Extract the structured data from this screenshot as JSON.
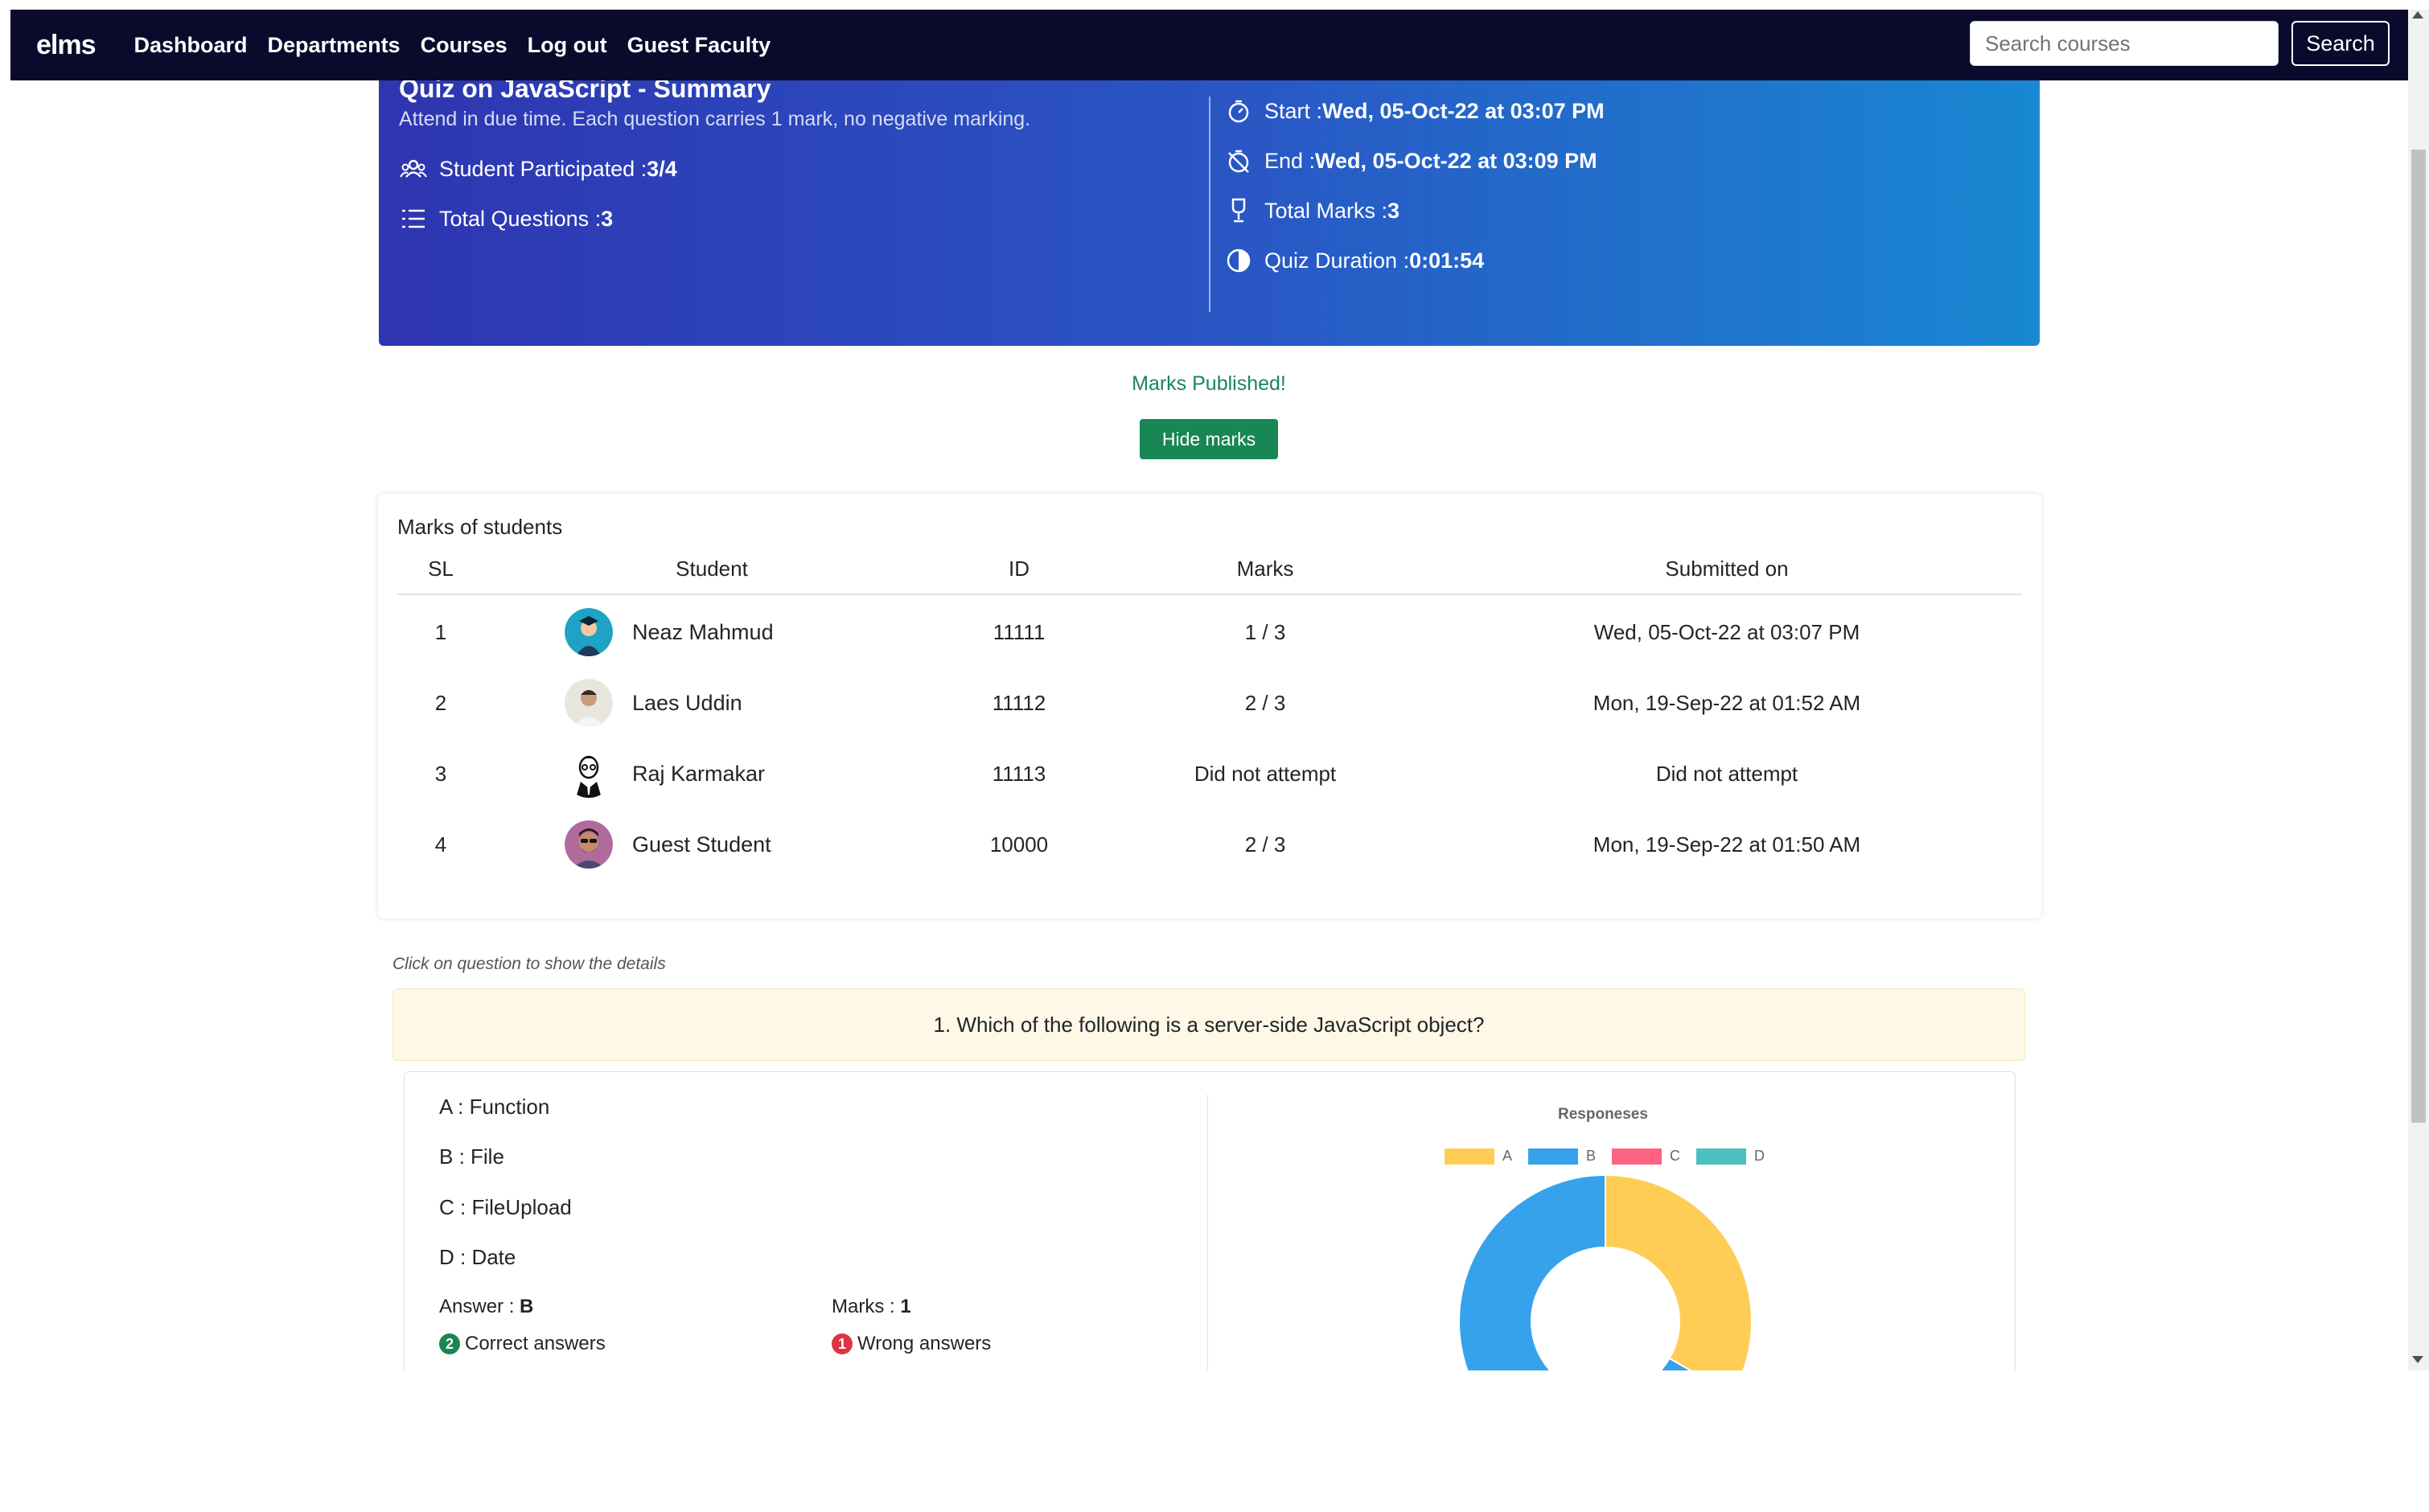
{
  "nav": {
    "brand": "elms",
    "links": [
      "Dashboard",
      "Departments",
      "Courses",
      "Log out",
      "Guest Faculty"
    ],
    "search_placeholder": "Search courses",
    "search_button": "Search"
  },
  "summary": {
    "title": "Quiz on JavaScript - Summary",
    "subtitle": "Attend in due time. Each question carries 1 mark, no negative marking.",
    "participated_label": "Student Participated : ",
    "participated_value": "3/4",
    "total_questions_label": "Total Questions : ",
    "total_questions_value": "3",
    "start_label": "Start : ",
    "start_value": "Wed, 05-Oct-22 at 03:07 PM",
    "end_label": "End : ",
    "end_value": "Wed, 05-Oct-22 at 03:09 PM",
    "total_marks_label": "Total Marks : ",
    "total_marks_value": "3",
    "duration_label": "Quiz Duration : ",
    "duration_value": "0:01:54"
  },
  "publish": {
    "status": "Marks Published!",
    "hide_button": "Hide marks"
  },
  "marks_table": {
    "title": "Marks of students",
    "headers": [
      "SL",
      "Student",
      "ID",
      "Marks",
      "Submitted on"
    ],
    "rows": [
      {
        "sl": "1",
        "name": "Neaz Mahmud",
        "id": "11111",
        "marks": "1 / 3",
        "submitted": "Wed, 05-Oct-22 at 03:07 PM",
        "avatar": "avatar-teal-graduate"
      },
      {
        "sl": "2",
        "name": "Laes Uddin",
        "id": "11112",
        "marks": "2 / 3",
        "submitted": "Mon, 19-Sep-22 at 01:52 AM",
        "avatar": "avatar-photo-man"
      },
      {
        "sl": "3",
        "name": "Raj Karmakar",
        "id": "11113",
        "marks": "Did not attempt",
        "submitted": "Did not attempt",
        "avatar": "avatar-cartoon-suit"
      },
      {
        "sl": "4",
        "name": "Guest Student",
        "id": "10000",
        "marks": "2 / 3",
        "submitted": "Mon, 19-Sep-22 at 01:50 AM",
        "avatar": "avatar-photo-sunglasses"
      }
    ]
  },
  "questions": {
    "hint": "Click on question to show the details",
    "items": [
      {
        "text": "1. Which of the following is a server-side JavaScript object?",
        "options": [
          "A : Function",
          "B : File",
          "C : FileUpload",
          "D : Date"
        ],
        "answer_label": "Answer : ",
        "answer_value": "B",
        "marks_label": "Marks : ",
        "marks_value": "1",
        "correct_count": "2",
        "correct_label": "Correct answers",
        "wrong_count": "1",
        "wrong_label": "Wrong answers"
      }
    ]
  },
  "chart_data": {
    "type": "pie",
    "title": "Responeses",
    "categories": [
      "A",
      "B",
      "C",
      "D"
    ],
    "values": [
      1,
      2,
      0,
      0
    ],
    "colors": [
      "#ffcd56",
      "#36a2eb",
      "#ff6384",
      "#4bc0c0"
    ],
    "legend": "top",
    "style": "doughnut"
  },
  "colors": {
    "navbar": "#0a0b2c",
    "banner_start": "#2e35b0",
    "banner_end": "#1888d2",
    "success": "#198754",
    "danger": "#dc3545",
    "question_bg": "#fff8e6"
  }
}
